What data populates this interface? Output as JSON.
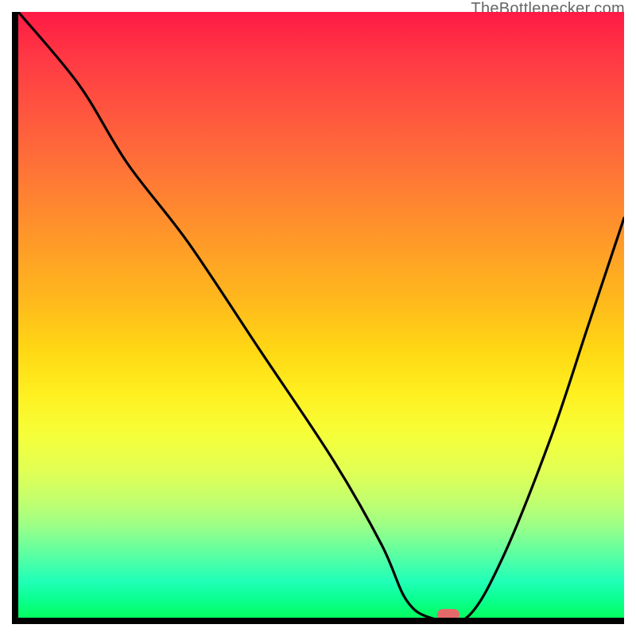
{
  "watermark": "TheBottlenecker.com",
  "chart_data": {
    "type": "line",
    "title": "",
    "xlabel": "",
    "ylabel": "",
    "xlim": [
      0,
      100
    ],
    "ylim": [
      0,
      100
    ],
    "background": "rainbow-gradient",
    "gradient_stops": [
      {
        "pos": 0,
        "color": "#ff1a45"
      },
      {
        "pos": 100,
        "color": "#05ff60"
      }
    ],
    "series": [
      {
        "name": "bottleneck-curve",
        "x": [
          0,
          10,
          18,
          28,
          40,
          52,
          60,
          64,
          68,
          74,
          80,
          88,
          94,
          100
        ],
        "y": [
          100,
          88,
          75,
          62,
          44,
          26,
          12,
          3,
          0,
          0,
          10,
          30,
          48,
          66
        ]
      }
    ],
    "marker": {
      "x": 71,
      "y": 0,
      "color": "#e46a6a"
    }
  }
}
